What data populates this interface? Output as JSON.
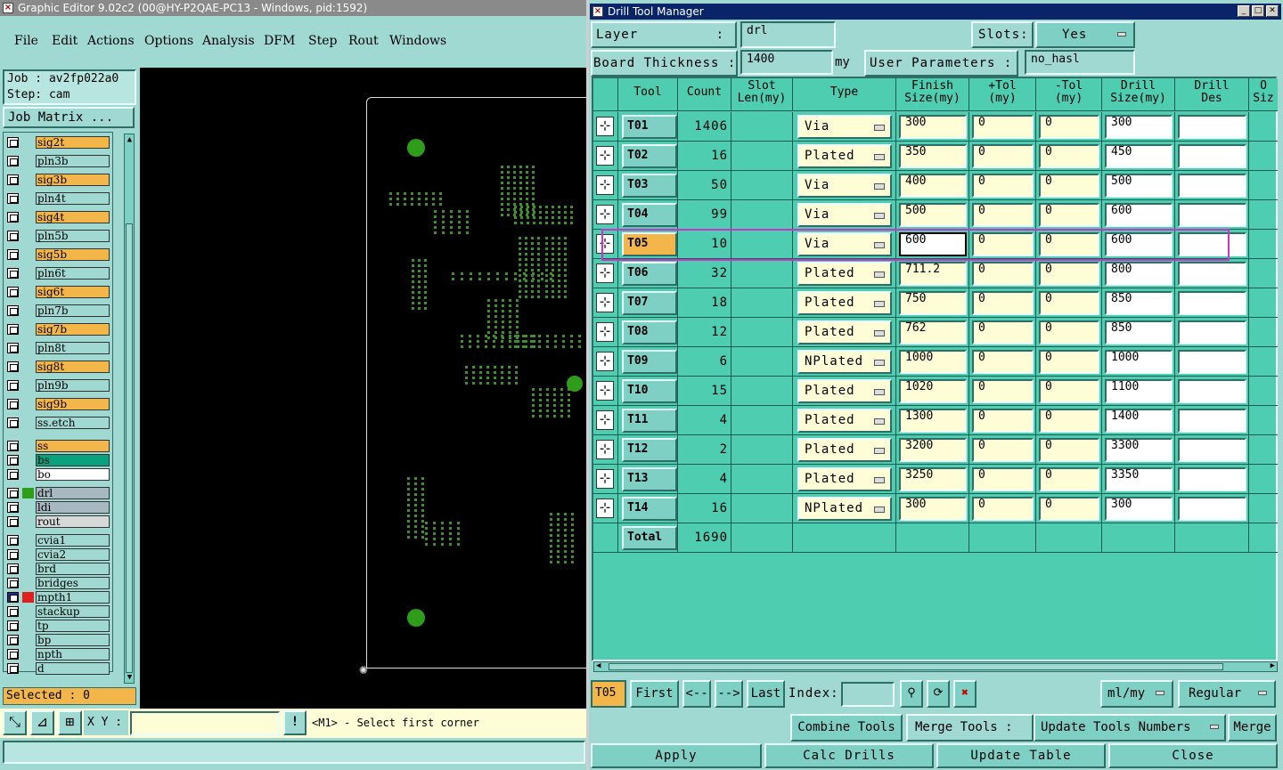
{
  "left_window": {
    "title": "Graphic Editor 9.02c2 (00@HY-P2QAE-PC13 - Windows, pid:1592)",
    "menu": [
      "File",
      "Edit",
      "Actions",
      "Options",
      "Analysis",
      "DFM",
      "Step",
      "Rout",
      "Windows"
    ],
    "job_label": "Job : av2fp022a0",
    "step_label": "Step: cam",
    "job_matrix_button": "Job Matrix ...",
    "layers": [
      {
        "name": "sig2t",
        "color": "#f2b64a"
      },
      {
        "name": "pln3b",
        "color": "#9fd9d2"
      },
      {
        "name": "sig3b",
        "color": "#f2b64a"
      },
      {
        "name": "pln4t",
        "color": "#9fd9d2"
      },
      {
        "name": "sig4t",
        "color": "#f2b64a"
      },
      {
        "name": "pln5b",
        "color": "#9fd9d2"
      },
      {
        "name": "sig5b",
        "color": "#f2b64a"
      },
      {
        "name": "pln6t",
        "color": "#9fd9d2"
      },
      {
        "name": "sig6t",
        "color": "#f2b64a"
      },
      {
        "name": "pln7b",
        "color": "#9fd9d2"
      },
      {
        "name": "sig7b",
        "color": "#f2b64a"
      },
      {
        "name": "pln8t",
        "color": "#9fd9d2"
      },
      {
        "name": "sig8t",
        "color": "#f2b64a"
      },
      {
        "name": "pln9b",
        "color": "#9fd9d2"
      },
      {
        "name": "sig9b",
        "color": "#f2b64a"
      },
      {
        "name": "ss.etch",
        "color": "#9fd9d2"
      },
      {
        "name": "ss",
        "color": "#f2b64a"
      },
      {
        "name": "bs",
        "color": "#0aa17e"
      },
      {
        "name": "bo",
        "color": "#ffffff"
      },
      {
        "name": "drl",
        "color": "#a8b8c0"
      },
      {
        "name": "ldi",
        "color": "#a8b8c0"
      },
      {
        "name": "rout",
        "color": "#d8d8d8"
      },
      {
        "name": "cvia1",
        "color": "#9fd9d2"
      },
      {
        "name": "cvia2",
        "color": "#9fd9d2"
      },
      {
        "name": "brd",
        "color": "#9fd9d2"
      },
      {
        "name": "bridges",
        "color": "#9fd9d2"
      },
      {
        "name": "mpth1",
        "color": "#9fd9d2"
      },
      {
        "name": "stackup",
        "color": "#9fd9d2"
      },
      {
        "name": "tp",
        "color": "#9fd9d2"
      },
      {
        "name": "bp",
        "color": "#9fd9d2"
      },
      {
        "name": "npth",
        "color": "#9fd9d2"
      },
      {
        "name": "d",
        "color": "#9fd9d2"
      }
    ],
    "selected_label": "Selected : 0",
    "xy_label": "X Y :",
    "xy_value": "",
    "status_message": "<M1> - Select first corner"
  },
  "drill_window": {
    "title": "Drill Tool Manager",
    "layer_label": "Layer",
    "layer_colon": ":",
    "layer_value": "drl",
    "slots_label": "Slots:",
    "slots_value": "Yes",
    "board_thickness_label": "Board Thickness :",
    "board_thickness_value": "1400",
    "board_thickness_unit": "my",
    "user_params_label": "User Parameters :",
    "user_params_value": "no_hasl",
    "columns": [
      "Tool",
      "Count",
      "Slot\nLen(my)",
      "Type",
      "Finish\nSize(my)",
      "+Tol\n(my)",
      "-Tol\n(my)",
      "Drill\nSize(my)",
      "Drill\nDes",
      "O\nSiz"
    ],
    "rows": [
      {
        "tool": "T01",
        "count": "1406",
        "type": "Via",
        "finish": "300",
        "ptol": "0",
        "mtol": "0",
        "drill": "300"
      },
      {
        "tool": "T02",
        "count": "16",
        "type": "Plated",
        "finish": "350",
        "ptol": "0",
        "mtol": "0",
        "drill": "450"
      },
      {
        "tool": "T03",
        "count": "50",
        "type": "Via",
        "finish": "400",
        "ptol": "0",
        "mtol": "0",
        "drill": "500"
      },
      {
        "tool": "T04",
        "count": "99",
        "type": "Via",
        "finish": "500",
        "ptol": "0",
        "mtol": "0",
        "drill": "600"
      },
      {
        "tool": "T05",
        "count": "10",
        "type": "Via",
        "finish": "600",
        "ptol": "0",
        "mtol": "0",
        "drill": "600"
      },
      {
        "tool": "T06",
        "count": "32",
        "type": "Plated",
        "finish": "711.2",
        "ptol": "0",
        "mtol": "0",
        "drill": "800"
      },
      {
        "tool": "T07",
        "count": "18",
        "type": "Plated",
        "finish": "750",
        "ptol": "0",
        "mtol": "0",
        "drill": "850"
      },
      {
        "tool": "T08",
        "count": "12",
        "type": "Plated",
        "finish": "762",
        "ptol": "0",
        "mtol": "0",
        "drill": "850"
      },
      {
        "tool": "T09",
        "count": "6",
        "type": "NPlated",
        "finish": "1000",
        "ptol": "0",
        "mtol": "0",
        "drill": "1000"
      },
      {
        "tool": "T10",
        "count": "15",
        "type": "Plated",
        "finish": "1020",
        "ptol": "0",
        "mtol": "0",
        "drill": "1100"
      },
      {
        "tool": "T11",
        "count": "4",
        "type": "Plated",
        "finish": "1300",
        "ptol": "0",
        "mtol": "0",
        "drill": "1400"
      },
      {
        "tool": "T12",
        "count": "2",
        "type": "Plated",
        "finish": "3200",
        "ptol": "0",
        "mtol": "0",
        "drill": "3300"
      },
      {
        "tool": "T13",
        "count": "4",
        "type": "Plated",
        "finish": "3250",
        "ptol": "0",
        "mtol": "0",
        "drill": "3350"
      },
      {
        "tool": "T14",
        "count": "16",
        "type": "NPlated",
        "finish": "300",
        "ptol": "0",
        "mtol": "0",
        "drill": "300"
      }
    ],
    "total_label": "Total",
    "total_value": "1690",
    "current_tool": "T05",
    "nav": {
      "first": "First",
      "prev": "<--",
      "next": "-->",
      "last": "Last",
      "index_label": "Index:",
      "units": "ml/my",
      "mode": "Regular"
    },
    "buttons": {
      "combine": "Combine Tools",
      "merge_label": "Merge Tools :",
      "update_numbers": "Update Tools Numbers",
      "merge": "Merge",
      "apply": "Apply",
      "calc": "Calc Drills",
      "update_table": "Update Table",
      "close": "Close"
    }
  },
  "colors": {
    "teal": "#9fd9d2",
    "grid": "#4ecdb0",
    "highlight": "#f2b64a",
    "selection_box": "#cc33cc"
  }
}
